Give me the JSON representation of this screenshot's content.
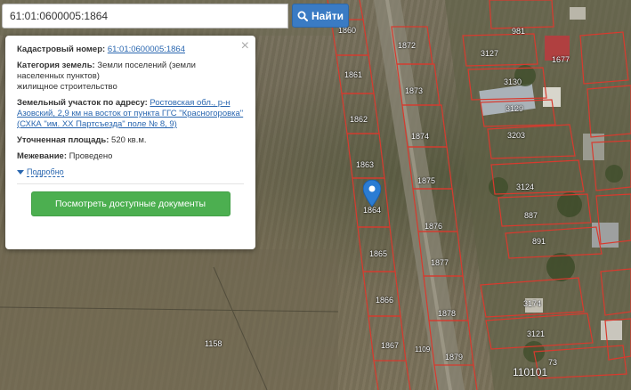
{
  "search": {
    "value": "61:01:0600005:1864",
    "button_label": "Найти"
  },
  "popup": {
    "cadastral_label": "Кадастровый номер:",
    "cadastral_value": "61:01:0600005:1864",
    "category_label": "Категория земель:",
    "category_value": "Земли поселений (земли населенных пунктов)",
    "category_use": "жилищное строительство",
    "address_label": "Земельный участок по адресу:",
    "address_value": "Ростовская обл., р-н Азовский, 2,9 км на восток от пункта ГГС \"Красногоровка\" (СХКА \"им. XX Партсъезда\" поле № 8, 9)",
    "area_label": "Уточненная площадь:",
    "area_value": "520 кв.м.",
    "survey_label": "Межевание:",
    "survey_value": "Проведено",
    "more_label": "Подробно",
    "docs_button": "Посмотреть доступные документы"
  },
  "map": {
    "parcel_labels": [
      "1860",
      "1861",
      "1862",
      "1863",
      "1864",
      "1865",
      "1866",
      "1867",
      "1872",
      "1873",
      "1874",
      "1875",
      "1876",
      "1877",
      "1878",
      "1879",
      "3127",
      "3130",
      "3129",
      "3203",
      "3124",
      "3174",
      "3121",
      "981",
      "1677",
      "887",
      "891",
      "73",
      "1158",
      "1109",
      "1101",
      "110101"
    ],
    "parcel_color": "#d83a2e"
  }
}
